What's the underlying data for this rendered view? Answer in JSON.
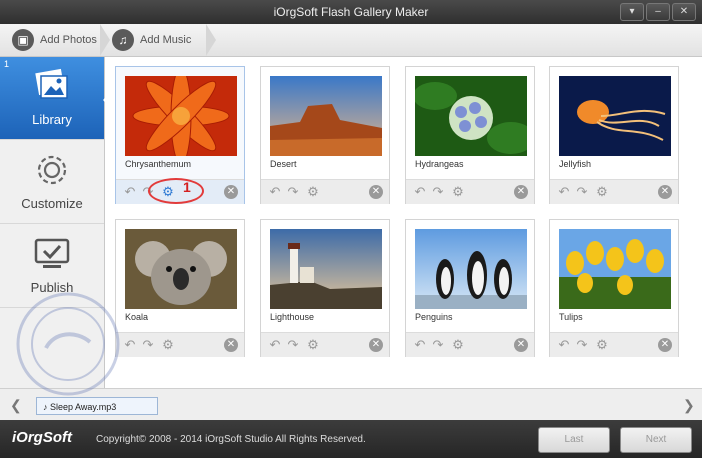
{
  "window": {
    "title": "iOrgSoft Flash Gallery Maker"
  },
  "toolbar": {
    "add_photos": "Add Photos",
    "add_music": "Add Music"
  },
  "sidebar": {
    "step": "1",
    "items": [
      {
        "label": "Library",
        "icon": "photos-icon"
      },
      {
        "label": "Customize",
        "icon": "gear-icon"
      },
      {
        "label": "Publish",
        "icon": "monitor-check-icon"
      }
    ]
  },
  "photos": [
    {
      "name": "Chrysanthemum"
    },
    {
      "name": "Desert"
    },
    {
      "name": "Hydrangeas"
    },
    {
      "name": "Jellyfish"
    },
    {
      "name": "Koala"
    },
    {
      "name": "Lighthouse"
    },
    {
      "name": "Penguins"
    },
    {
      "name": "Tulips"
    }
  ],
  "annotation": {
    "number": "1"
  },
  "music": {
    "track": "Sleep Away.mp3"
  },
  "footer": {
    "logo": "iOrgSoft",
    "copyright": "Copyright© 2008 - 2014 iOrgSoft Studio All Rights Reserved.",
    "last": "Last",
    "next": "Next"
  },
  "colors": {
    "accent": "#2f7ad3",
    "annotation": "#e23b3b"
  }
}
